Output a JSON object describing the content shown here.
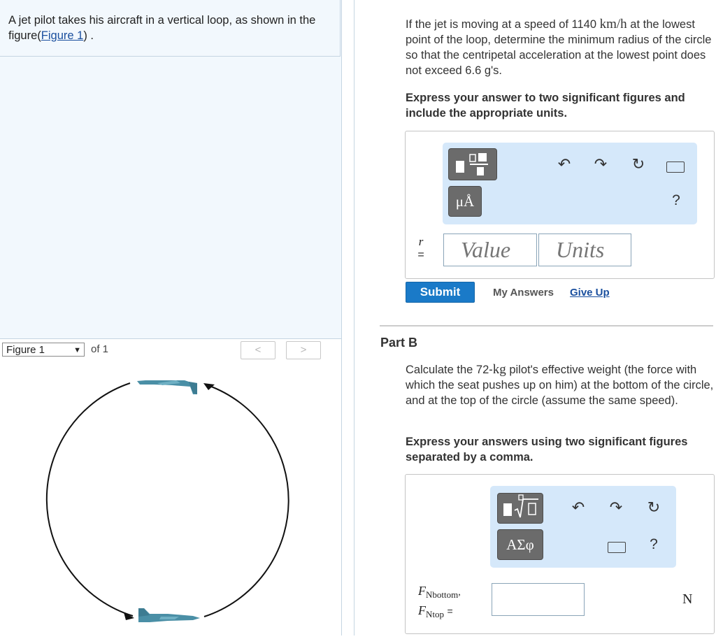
{
  "intro": {
    "text_before": "A jet pilot takes his aircraft in a vertical loop, as shown in the figure(",
    "figure_link": "Figure 1",
    "text_after": ") ."
  },
  "figure_nav": {
    "selected": "Figure 1",
    "of_label": "of 1",
    "prev_glyph": "<",
    "next_glyph": ">"
  },
  "part_a": {
    "question_1": "If the jet is moving at a speed of 1140 ",
    "speed_units": "km/h",
    "question_2": " at the lowest point of the loop, determine the minimum radius of the circle so that the centripetal acceleration at the lowest point does not exceed 6.6 g's.",
    "instruction": "Express your answer to two significant figures and include the appropriate units.",
    "toolbar": {
      "symbols_label": "μÅ",
      "help_label": "?"
    },
    "var_label": "r",
    "equals": "=",
    "value_placeholder": "Value",
    "units_placeholder": "Units",
    "submit_label": "Submit",
    "my_answers_label": "My Answers",
    "give_up_label": "Give Up"
  },
  "part_b": {
    "title": "Part B",
    "question_1": "Calculate the 72-",
    "mass_units": "kg",
    "question_2": " pilot's effective weight (the force with which the seat pushes up on him) at the bottom of the circle, and at the top of the circle (assume the same speed).",
    "instruction": "Express your answers using two significant figures separated by a comma.",
    "toolbar": {
      "symbols_label": "ΑΣφ",
      "help_label": "?"
    },
    "var_label_1": "F",
    "var_sub_1": "Nbottom",
    "var_comma": ",",
    "var_label_2": "F",
    "var_sub_2": "Ntop",
    "equals": "=",
    "answer_value": "",
    "units_label": "N"
  },
  "colors": {
    "jet": "#4a8fa6",
    "submit_bg": "#1a7ac8",
    "toolbar_bg": "#d5e8fa",
    "link": "#1a4f9e"
  }
}
